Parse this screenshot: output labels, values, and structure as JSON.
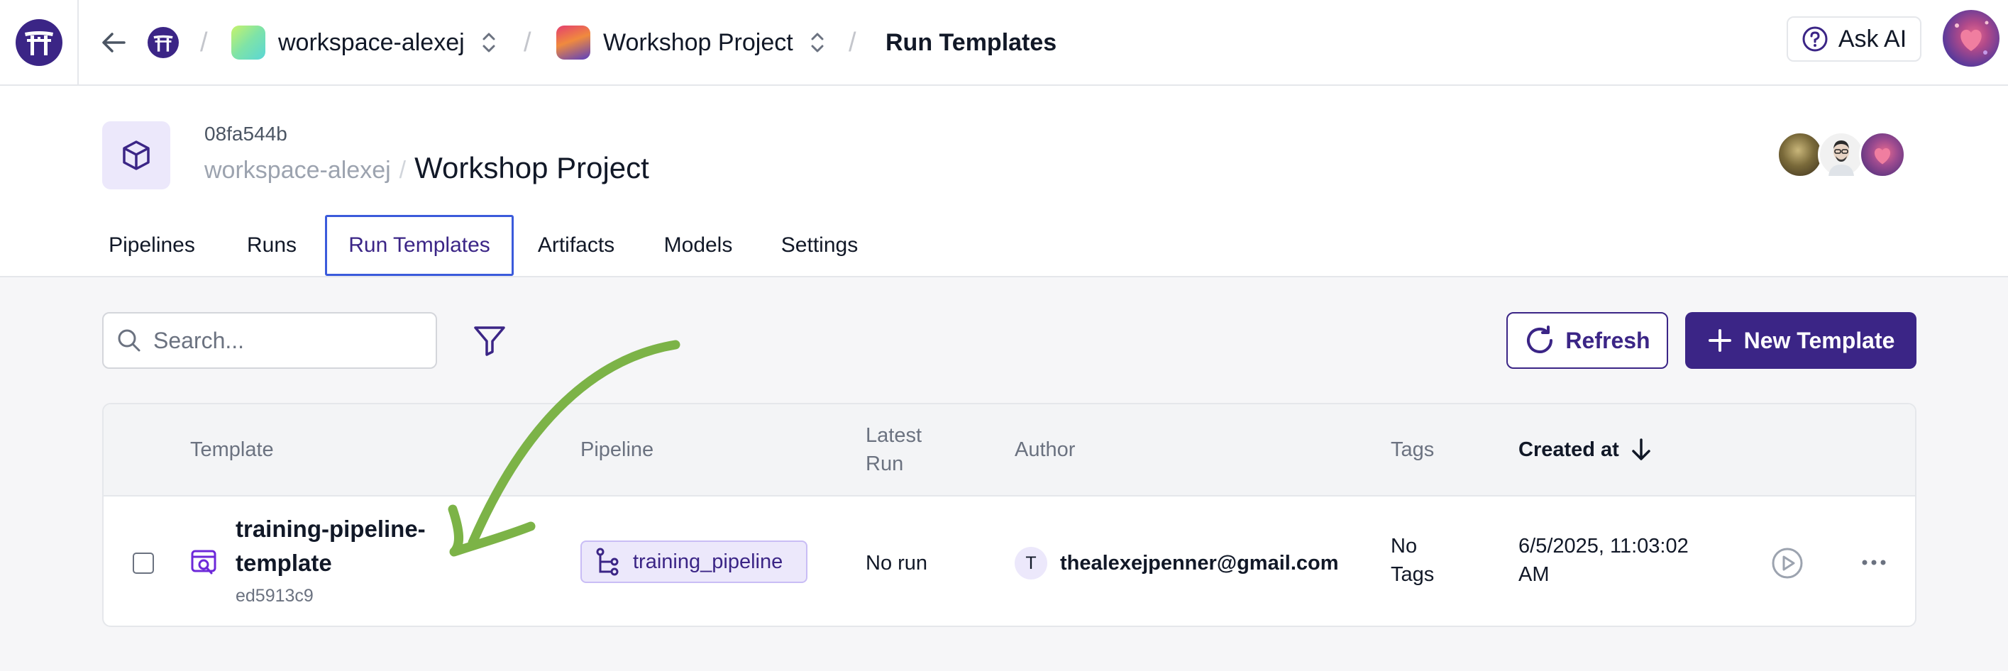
{
  "topbar": {
    "workspace": "workspace-alexej",
    "project": "Workshop Project",
    "current_page": "Run Templates",
    "ask_ai_label": "Ask AI"
  },
  "project_header": {
    "project_id": "08fa544b",
    "workspace": "workspace-alexej",
    "separator": "/",
    "project_name": "Workshop Project"
  },
  "tabs": [
    {
      "label": "Pipelines",
      "active": false
    },
    {
      "label": "Runs",
      "active": false
    },
    {
      "label": "Run Templates",
      "active": true
    },
    {
      "label": "Artifacts",
      "active": false
    },
    {
      "label": "Models",
      "active": false
    },
    {
      "label": "Settings",
      "active": false
    }
  ],
  "toolbar": {
    "search_placeholder": "Search...",
    "refresh_label": "Refresh",
    "new_template_label": "New Template"
  },
  "table": {
    "columns": {
      "template": "Template",
      "pipeline": "Pipeline",
      "latest_run": "Latest Run",
      "author": "Author",
      "tags": "Tags",
      "created_at": "Created at"
    },
    "rows": [
      {
        "template_name": "training-pipeline-template",
        "template_id": "ed5913c9",
        "pipeline": "training_pipeline",
        "latest_run": "No run",
        "author_initial": "T",
        "author_email": "thealexejpenner@gmail.com",
        "tags": "No Tags",
        "created_at": "6/5/2025, 11:03:02 AM"
      }
    ]
  },
  "colors": {
    "brand": "#3b2586",
    "brand_light": "#ece8fb",
    "active_tab_border": "#3b5bdb",
    "annotation_arrow": "#7cb347"
  }
}
